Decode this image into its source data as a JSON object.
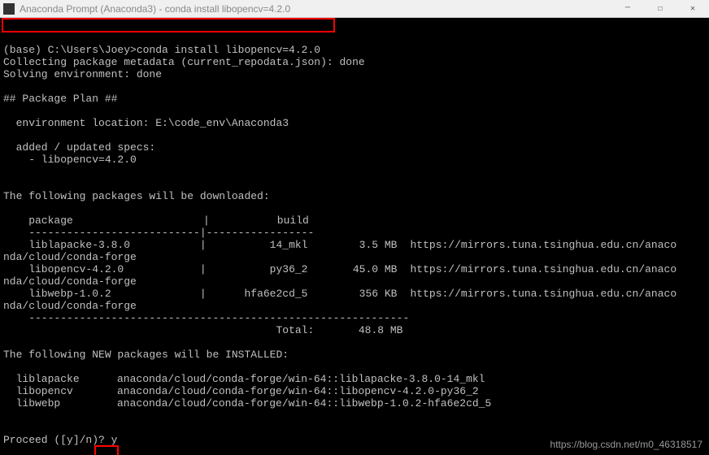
{
  "window": {
    "title": "Anaconda Prompt (Anaconda3) - conda  install libopencv=4.2.0"
  },
  "prompt": {
    "prefix": "(base) C:\\Users\\Joey>",
    "command": "conda install libopencv=4.2.0"
  },
  "lines": {
    "collecting": "Collecting package metadata (current_repodata.json): done",
    "solving": "Solving environment: done",
    "plan_header": "## Package Plan ##",
    "env_loc": "  environment location: E:\\code_env\\Anaconda3",
    "added_specs": "  added / updated specs:",
    "spec1": "    - libopencv=4.2.0",
    "downloaded_header": "The following packages will be downloaded:",
    "pkg_hdr_pkg": "    package",
    "pkg_hdr_build": "build",
    "sep1": "    ---------------------------|-----------------",
    "sep_total": "    ------------------------------------------------------------",
    "total_label": "                                           Total:",
    "total_size": "       48.8 MB",
    "new_header": "The following NEW packages will be INSTALLED:",
    "proceed": "Proceed ([y]/n)? ",
    "proceed_answer": "y"
  },
  "packages": [
    {
      "name": "    liblapacke-3.8.0",
      "sep": "           |",
      "build": "          14_mkl",
      "size": "3.5 MB",
      "url": "https://mirrors.tuna.tsinghua.edu.cn/anaco",
      "extra": "nda/cloud/conda-forge"
    },
    {
      "name": "    libopencv-4.2.0",
      "sep": "            |",
      "build": "          py36_2",
      "size": "45.0 MB",
      "url": "https://mirrors.tuna.tsinghua.edu.cn/anaco",
      "extra": "nda/cloud/conda-forge"
    },
    {
      "name": "    libwebp-1.0.2",
      "sep": "              |",
      "build": "      hfa6e2cd_5",
      "size": "356 KB",
      "url": "https://mirrors.tuna.tsinghua.edu.cn/anaco",
      "extra": "nda/cloud/conda-forge"
    }
  ],
  "installs": [
    {
      "name": "  liblapacke",
      "src": "anaconda/cloud/conda-forge/win-64::liblapacke-3.8.0-14_mkl"
    },
    {
      "name": "  libopencv",
      "src": "anaconda/cloud/conda-forge/win-64::libopencv-4.2.0-py36_2"
    },
    {
      "name": "  libwebp",
      "src": "anaconda/cloud/conda-forge/win-64::libwebp-1.0.2-hfa6e2cd_5"
    }
  ],
  "watermark": "https://blog.csdn.net/m0_46318517"
}
